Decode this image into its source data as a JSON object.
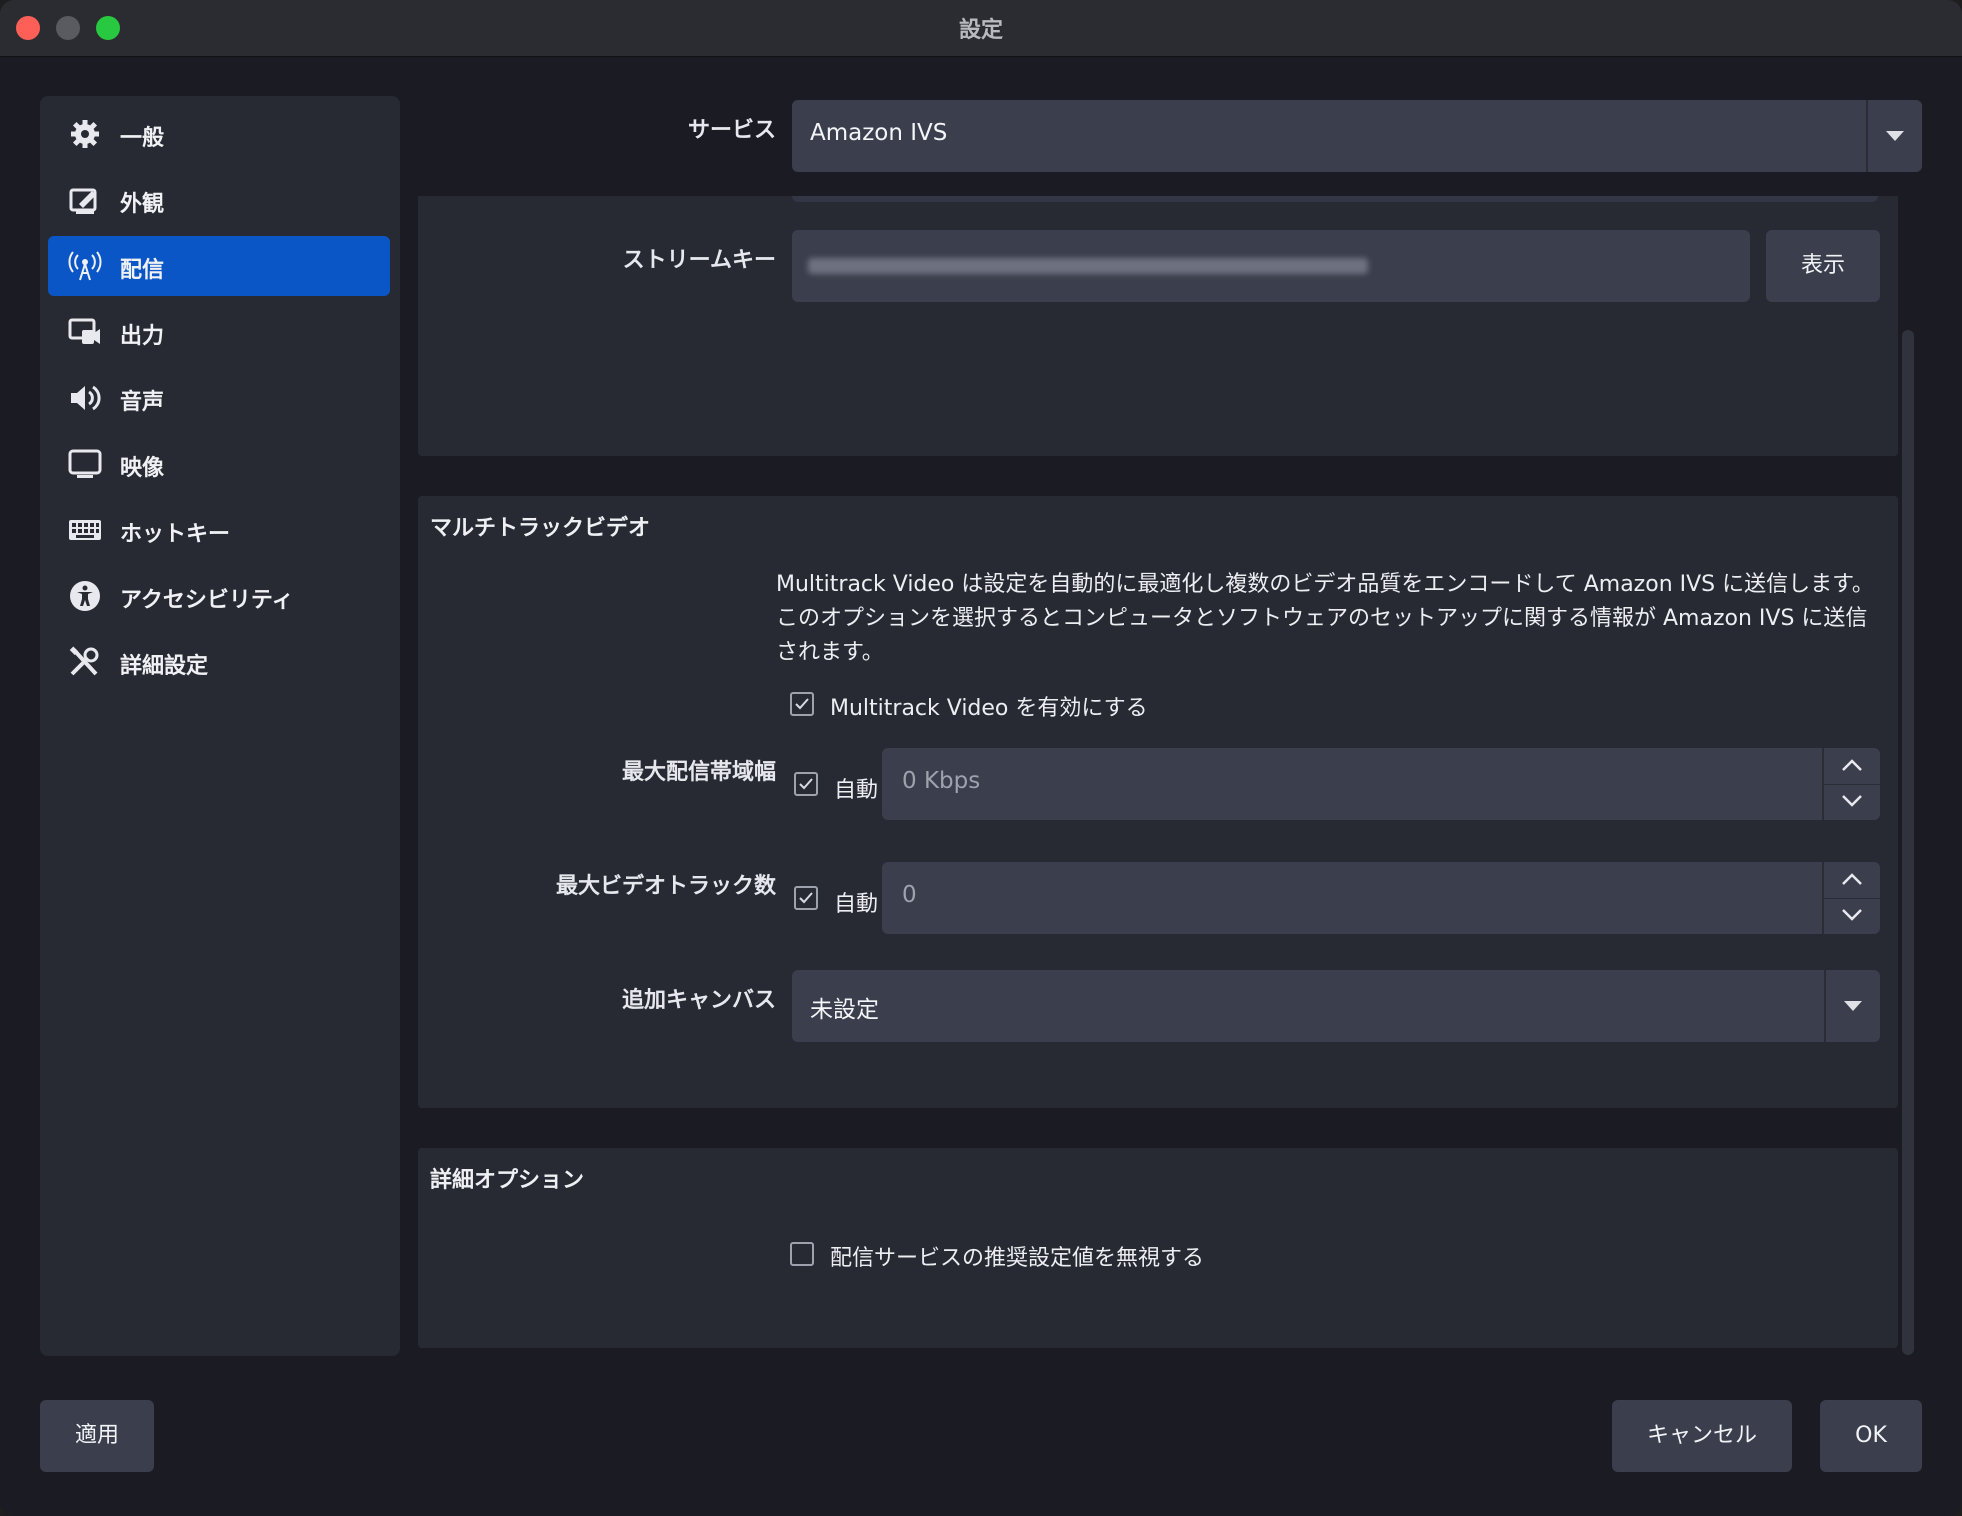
{
  "window": {
    "title": "設定"
  },
  "sidebar": {
    "items": [
      {
        "label": "一般",
        "icon": "gear-icon"
      },
      {
        "label": "外観",
        "icon": "appearance-icon"
      },
      {
        "label": "配信",
        "icon": "antenna-icon",
        "active": true
      },
      {
        "label": "出力",
        "icon": "output-icon"
      },
      {
        "label": "音声",
        "icon": "speaker-icon"
      },
      {
        "label": "映像",
        "icon": "monitor-icon"
      },
      {
        "label": "ホットキー",
        "icon": "keyboard-icon"
      },
      {
        "label": "アクセシビリティ",
        "icon": "accessibility-icon"
      },
      {
        "label": "詳細設定",
        "icon": "tools-icon"
      }
    ]
  },
  "stream": {
    "service_label": "サービス",
    "service_value": "Amazon IVS",
    "stream_key_label": "ストリームキー",
    "show_button": "表示"
  },
  "multitrack": {
    "title": "マルチトラックビデオ",
    "description": "Multitrack Video は設定を自動的に最適化し複数のビデオ品質をエンコードして Amazon IVS に送信します。 このオプションを選択するとコンピュータとソフトウェアのセットアップに関する情報が Amazon IVS に送信されます。",
    "enable_label": "Multitrack Video を有効にする",
    "enable_checked": true,
    "max_bitrate_label": "最大配信帯域幅",
    "max_bitrate_auto_label": "自動",
    "max_bitrate_value": "0 Kbps",
    "max_tracks_label": "最大ビデオトラック数",
    "max_tracks_auto_label": "自動",
    "max_tracks_value": "0",
    "extra_canvas_label": "追加キャンバス",
    "extra_canvas_value": "未設定"
  },
  "advanced": {
    "title": "詳細オプション",
    "ignore_label": "配信サービスの推奨設定値を無視する",
    "ignore_checked": false
  },
  "footer": {
    "apply": "適用",
    "cancel": "キャンセル",
    "ok": "OK"
  }
}
